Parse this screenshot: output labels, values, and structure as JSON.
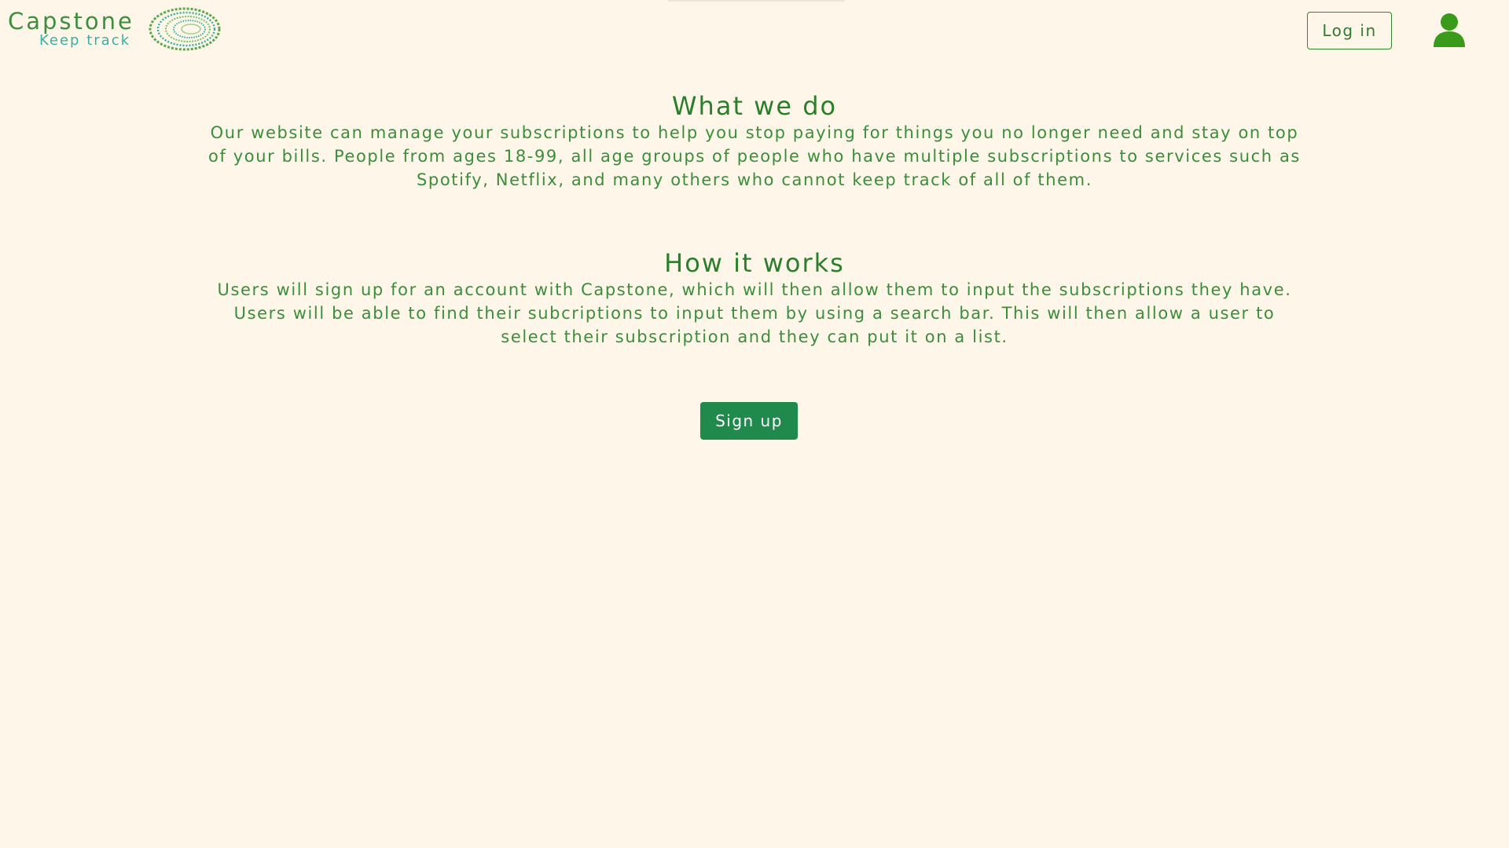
{
  "header": {
    "logo_title": "Capstone",
    "logo_subtitle": "Keep track",
    "login_label": "Log in",
    "user_icon": "user-icon"
  },
  "sections": [
    {
      "heading": "What we do",
      "body": "Our website can manage your subscriptions to help you stop paying for things you no longer need and stay on top of your bills. People from ages 18-99, all age groups of people who have multiple subscriptions to services such as Spotify, Netflix, and many others who cannot keep track of all of them."
    },
    {
      "heading": "How it works",
      "body": "Users will sign up for an account with Capstone, which will then allow them to input the subscriptions they have. Users will be able to find their subcriptions to input them by using a search bar. This will then allow a user to select their subscription and they can put it on a list."
    }
  ],
  "cta": {
    "signup_label": "Sign up"
  },
  "colors": {
    "background": "#fdf6e9",
    "primary_green": "#2e8a2e",
    "accent_teal": "#3ab0a0",
    "button_green": "#1f8a4c",
    "user_icon_green": "#3a9a1a"
  }
}
